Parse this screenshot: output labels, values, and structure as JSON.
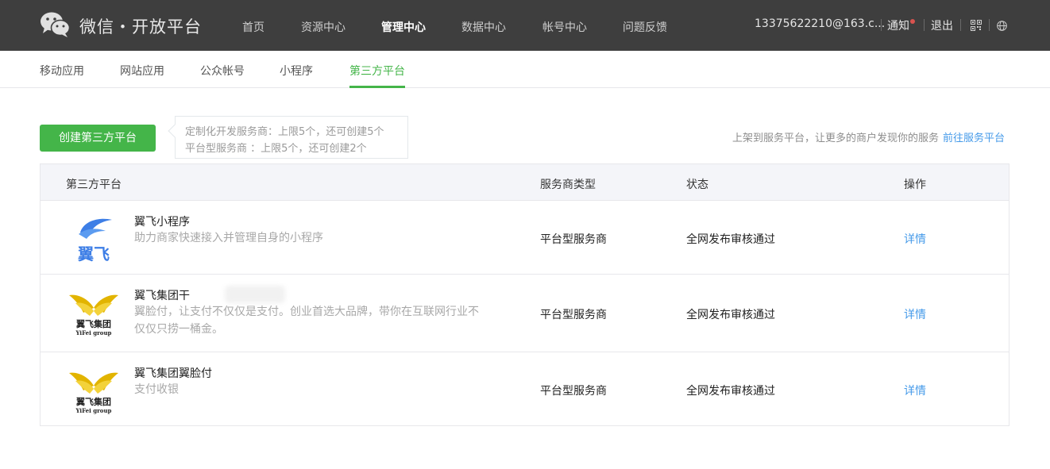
{
  "header": {
    "brand": "微信・开放平台",
    "nav": [
      "首页",
      "资源中心",
      "管理中心",
      "数据中心",
      "帐号中心",
      "问题反馈"
    ],
    "active_nav": "管理中心",
    "account": "13375622210@163.c...",
    "notify": "通知",
    "logout": "退出"
  },
  "subnav": {
    "tabs": [
      "移动应用",
      "网站应用",
      "公众帐号",
      "小程序",
      "第三方平台"
    ],
    "active": "第三方平台"
  },
  "toolbar": {
    "create_label": "创建第三方平台",
    "quota_custom": "定制化开发服务商：上限5个，还可创建5个",
    "quota_platform": "平台型服务商 ：上限5个，还可创建2个",
    "promo_text": "上架到服务平台，让更多的商户发现你的服务",
    "promo_link": "前往服务平台"
  },
  "table": {
    "headers": [
      "第三方平台",
      "服务商类型",
      "状态",
      "操作"
    ],
    "rows": [
      {
        "name": "翼飞小程序",
        "desc": "助力商家快速接入并管理自身的小程序",
        "logo_text": "翼飞",
        "type": "平台型服务商",
        "status": "全网发布审核通过",
        "action": "详情"
      },
      {
        "name": "翼飞集团干",
        "desc": "翼脸付，让支付不仅仅是支付。创业首选大品牌，带你在互联网行业不仅仅只捞一桶金。",
        "logo_text": "翼飞集团",
        "logo_sub": "YiFei group",
        "type": "平台型服务商",
        "status": "全网发布审核通过",
        "action": "详情"
      },
      {
        "name": "翼飞集团翼脸付",
        "desc": "支付收银",
        "logo_text": "翼飞集团",
        "logo_sub": "YiFei group",
        "type": "平台型服务商",
        "status": "全网发布审核通过",
        "action": "详情"
      }
    ]
  },
  "colors": {
    "topbar": "#3e3e3e",
    "accent_green": "#44b549",
    "link_blue": "#459ae9",
    "logo_blue": "#3d7ee6",
    "logo_gold": "#e2b400"
  }
}
